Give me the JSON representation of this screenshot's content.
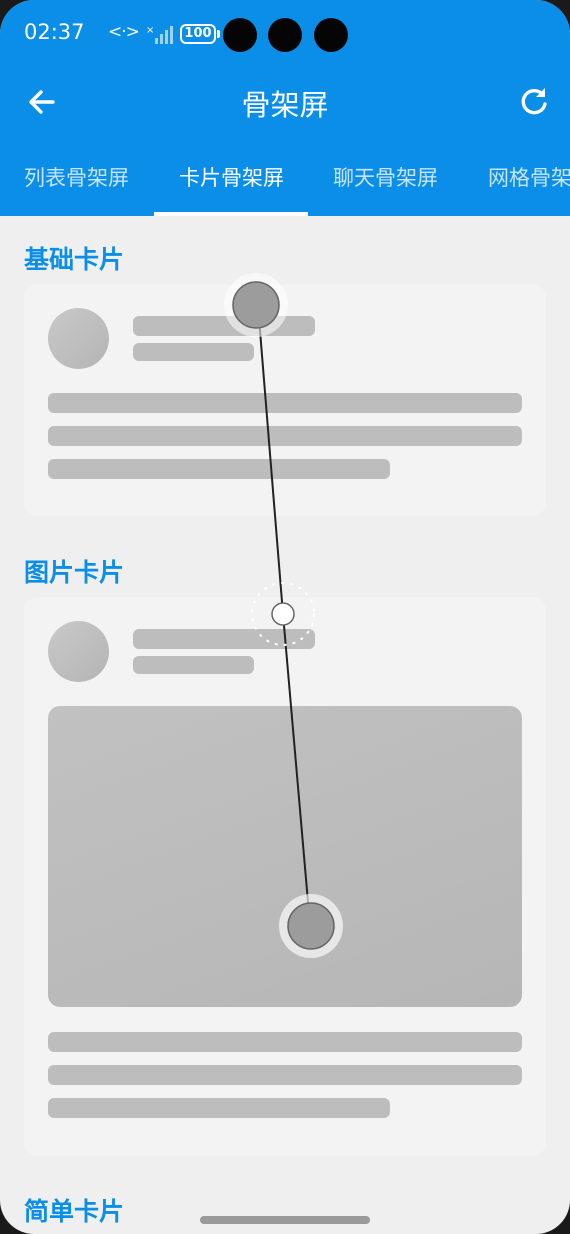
{
  "status_bar": {
    "time": "02:37",
    "network_icon": "data-transfer-icon",
    "battery": "100"
  },
  "header": {
    "title": "骨架屏",
    "back_icon": "arrow-left-icon",
    "refresh_icon": "refresh-icon"
  },
  "tabs": [
    {
      "label": "列表骨架屏",
      "active": false
    },
    {
      "label": "卡片骨架屏",
      "active": true
    },
    {
      "label": "聊天骨架屏",
      "active": false
    },
    {
      "label": "网格骨架屏",
      "active": false
    }
  ],
  "sections": [
    {
      "title": "基础卡片"
    },
    {
      "title": "图片卡片"
    },
    {
      "title": "简单卡片"
    }
  ],
  "colors": {
    "primary": "#0a8ee8",
    "background": "#efefef",
    "card": "#f3f3f3",
    "skeleton": "#bdbdbd"
  }
}
